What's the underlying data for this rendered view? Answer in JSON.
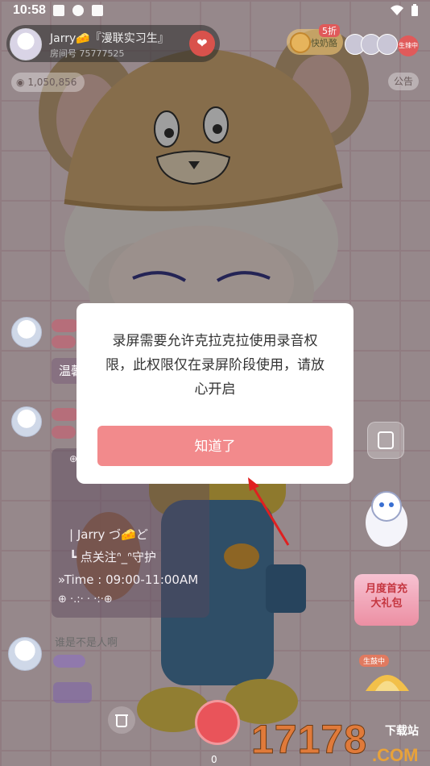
{
  "status_bar": {
    "time": "10:58"
  },
  "host": {
    "name": "Jarry🧀『漫联实习生』",
    "room": "房间号 75777525"
  },
  "rank_badge": {
    "tag": "5折",
    "label": "快奶酪"
  },
  "live_badge": "生辣中",
  "coins": "1,050,856",
  "notice": "公告",
  "welcome_text": "温馨",
  "card": {
    "top_emoji": "⊕ · · · ⊕",
    "name_line": "| Jarry  づ🧀ど",
    "follow_line": "┗ 点关注ᐢ_ᐢ守护",
    "time_line": "»Time : 09:00-11:00AM",
    "bottom_line": "⊕ ·.:· · ·:·⊕"
  },
  "chat_message": "谁是不是人啊",
  "promo": {
    "line1": "月度首充",
    "line2": "大礼包"
  },
  "gift_label": "生鼓中",
  "counter": "0",
  "watermark": {
    "number": "17178",
    "site": "下载站",
    "domain": ".COM"
  },
  "dialog": {
    "message": "录屏需要允许克拉克拉使用录音权限，此权限仅在录屏阶段使用，请放心开启",
    "ok_label": "知道了"
  },
  "colors": {
    "accent": "#f28a8c",
    "record": "#e9545a"
  }
}
